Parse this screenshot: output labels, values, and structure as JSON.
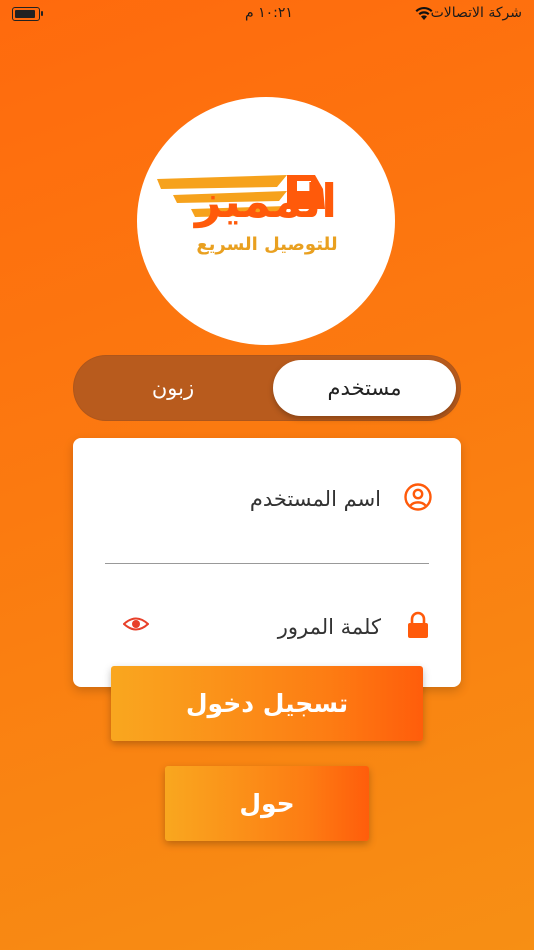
{
  "status_bar": {
    "carrier": "شركة الاتصالات",
    "time": "١٠:٢١ م"
  },
  "logo": {
    "title": "المميز",
    "subtitle": "للتوصيل السريع"
  },
  "account_type_toggle": {
    "selected": "مستخدم",
    "other": "زبون"
  },
  "login_form": {
    "username_placeholder": "اسم المستخدم",
    "password_placeholder": "كلمة المرور"
  },
  "buttons": {
    "login_label": "تسجيل دخول",
    "about_label": "حول"
  },
  "colors": {
    "accent": "#ff5a0a",
    "secondary": "#f9a71f",
    "toggle_bg": "#b85b1d"
  }
}
